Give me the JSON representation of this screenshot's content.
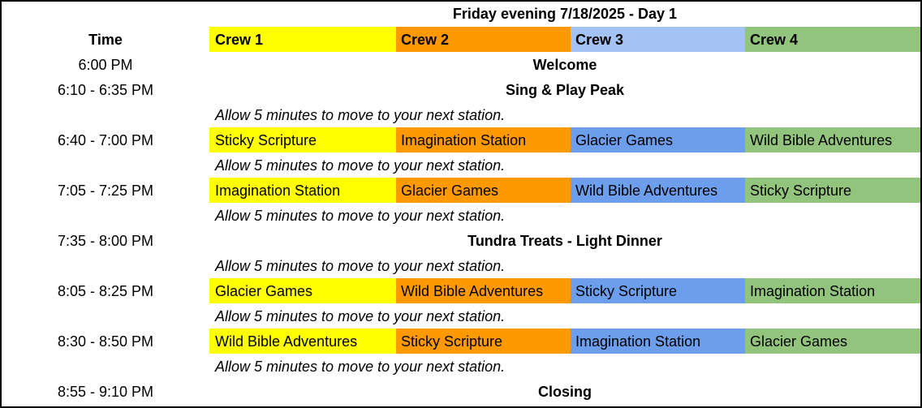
{
  "title": "Friday evening 7/18/2025 - Day 1",
  "colors": {
    "crew1": "#ffff00",
    "crew2": "#ff9900",
    "crew3_header": "#a4c2f4",
    "crew3": "#6d9eeb",
    "crew4": "#93c47d"
  },
  "header": {
    "time": "Time",
    "crews": [
      "Crew 1",
      "Crew 2",
      "Crew 3",
      "Crew 4"
    ]
  },
  "rows": [
    {
      "time": "6:00 PM",
      "span": "Welcome"
    },
    {
      "time": "6:10 - 6:35 PM",
      "span": "Sing & Play Peak"
    },
    {
      "note": "Allow 5 minutes to move to your next station."
    },
    {
      "time": "6:40 - 7:00 PM",
      "cells": [
        "Sticky Scripture",
        "Imagination Station",
        "Glacier Games",
        "Wild Bible Adventures"
      ]
    },
    {
      "note": "Allow 5 minutes to move to your next station."
    },
    {
      "time": "7:05 - 7:25 PM",
      "cells": [
        "Imagination Station",
        "Glacier Games",
        "Wild Bible Adventures",
        "Sticky Scripture"
      ]
    },
    {
      "note": "Allow 5 minutes to move to your next station."
    },
    {
      "time": "7:35 - 8:00 PM",
      "span": "Tundra Treats - Light Dinner"
    },
    {
      "note": "Allow 5 minutes to move to your next station."
    },
    {
      "time": "8:05 - 8:25 PM",
      "cells": [
        "Glacier Games",
        "Wild Bible Adventures",
        "Sticky Scripture",
        "Imagination Station"
      ]
    },
    {
      "note": "Allow 5 minutes to move to your next station."
    },
    {
      "time": "8:30 - 8:50 PM",
      "cells": [
        "Wild Bible Adventures",
        "Sticky Scripture",
        "Imagination Station",
        "Glacier Games"
      ]
    },
    {
      "note": "Allow 5 minutes to move to your next station."
    },
    {
      "time": "8:55 - 9:10 PM",
      "span": "Closing"
    }
  ]
}
